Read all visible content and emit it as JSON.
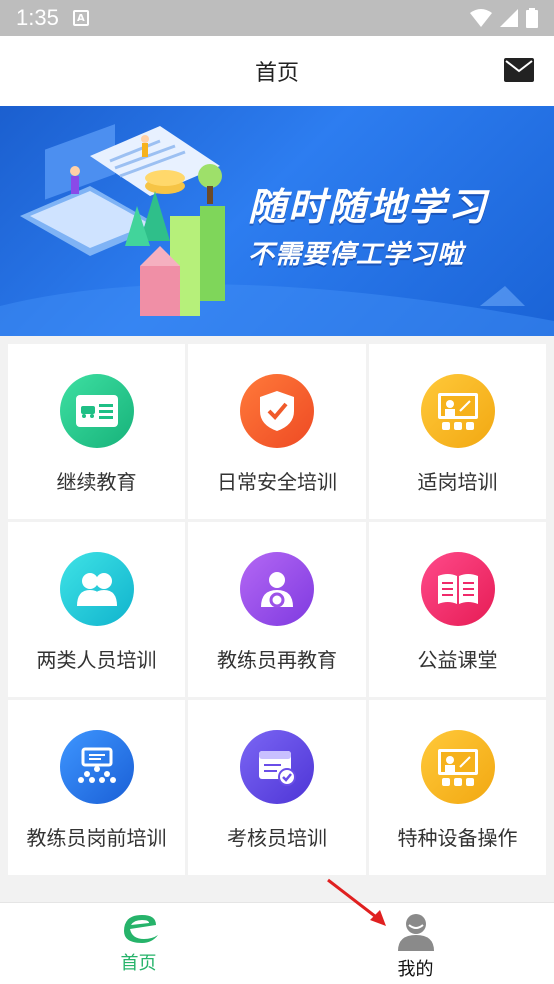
{
  "status_bar": {
    "time": "1:35",
    "notif_letter": "A"
  },
  "header": {
    "title": "首页"
  },
  "banner": {
    "line1": "随时随地学习",
    "line2": "不需要停工学习啦"
  },
  "grid": {
    "items": [
      {
        "label": "继续教育",
        "icon": "car-card-icon",
        "color": "#22c48a"
      },
      {
        "label": "日常安全培训",
        "icon": "shield-check-icon",
        "color": "#f25a2a"
      },
      {
        "label": "适岗培训",
        "icon": "teacher-board-icon",
        "color": "#f6b21c"
      },
      {
        "label": "两类人员培训",
        "icon": "two-people-icon",
        "color": "#1fc6d6"
      },
      {
        "label": "教练员再教育",
        "icon": "driver-icon",
        "color": "#9c52e8"
      },
      {
        "label": "公益课堂",
        "icon": "open-book-icon",
        "color": "#f02a6a"
      },
      {
        "label": "教练员岗前培训",
        "icon": "classroom-icon",
        "color": "#2d7df0"
      },
      {
        "label": "考核员培训",
        "icon": "exam-check-icon",
        "color": "#6a4ee8"
      },
      {
        "label": "特种设备操作",
        "icon": "teacher-board-icon",
        "color": "#f6b21c"
      }
    ]
  },
  "bottom_nav": {
    "home_label": "首页",
    "mine_label": "我的",
    "accent": "#26b36a"
  }
}
